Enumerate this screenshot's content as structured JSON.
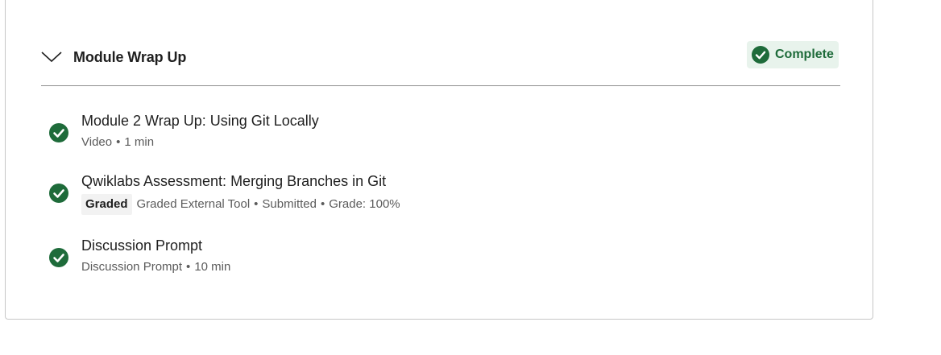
{
  "module": {
    "title": "Module Wrap Up",
    "status": "Complete",
    "status_color": "#1e6b3a",
    "check_color": "#1e6b3a"
  },
  "items": [
    {
      "title": "Module 2 Wrap Up: Using Git Locally",
      "type": "Video",
      "duration": "1 min",
      "icon": "check-circle-icon"
    },
    {
      "title": "Qwiklabs Assessment: Merging Branches in Git",
      "badge": "Graded",
      "type": "Graded External Tool",
      "submission": "Submitted",
      "grade": "Grade: 100%",
      "icon": "check-circle-icon"
    },
    {
      "title": "Discussion Prompt",
      "type": "Discussion Prompt",
      "duration": "10 min",
      "icon": "check-circle-icon"
    }
  ],
  "separator": "•"
}
